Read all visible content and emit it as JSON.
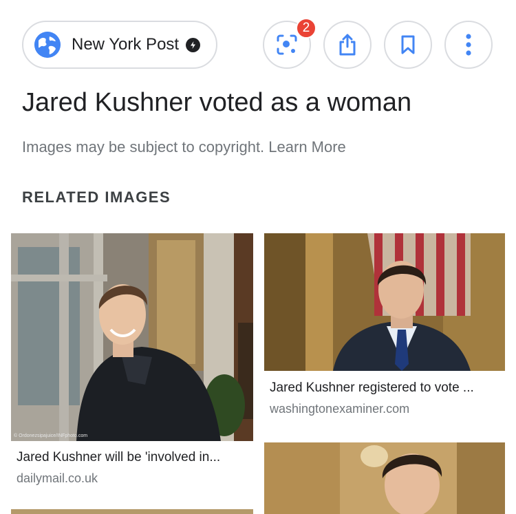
{
  "source_chip": {
    "name": "New York Post"
  },
  "header_actions": {
    "lens_badge_count": "2",
    "icons": [
      "lens-icon",
      "share-icon",
      "bookmark-icon",
      "more-vert-icon"
    ]
  },
  "title": "Jared Kushner voted as a woman",
  "copyright_notice": "Images may be subject to copyright. Learn More",
  "related": {
    "header": "RELATED IMAGES",
    "items": [
      {
        "caption": "Jared Kushner will be 'involved in...",
        "domain": "dailymail.co.uk",
        "credit": "© Ordonezsipajuice/INFphoto.com"
      },
      {
        "caption": "Jared Kushner registered to vote ...",
        "domain": "washingtonexaminer.com"
      },
      {
        "caption": "",
        "domain": ""
      }
    ]
  },
  "colors": {
    "accent_blue": "#4285f4",
    "badge_red": "#ea4335",
    "text_primary": "#202124",
    "text_secondary": "#70757a",
    "border": "#dadce0"
  }
}
